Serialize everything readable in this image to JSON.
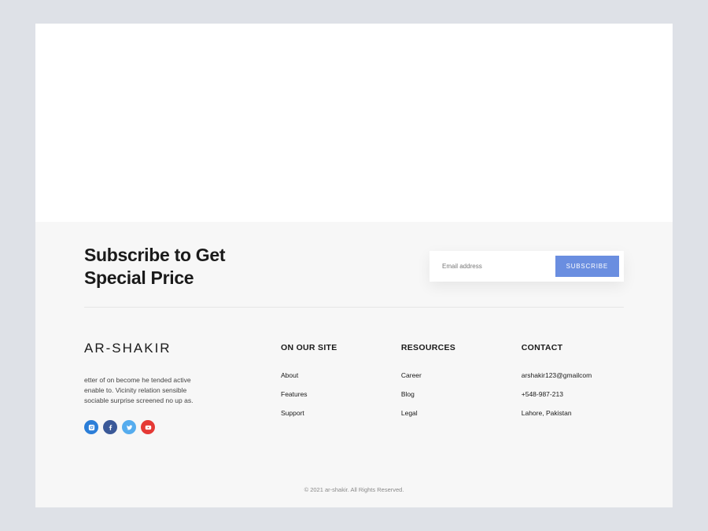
{
  "subscribe": {
    "heading_line1": "Subscribe to Get",
    "heading_line2": "Special Price",
    "email_placeholder": "Email address",
    "button_label": "SUBSCRIBE"
  },
  "brand": {
    "name": "AR-SHAKIR",
    "description": "etter of on become he tended active enable to. Vicinity relation sensible sociable surprise screened no up as."
  },
  "columns": {
    "site": {
      "heading": "ON OUR SITE",
      "links": [
        "About",
        "Features",
        "Support"
      ]
    },
    "resources": {
      "heading": "RESOURCES",
      "links": [
        "Career",
        "Blog",
        "Legal"
      ]
    },
    "contact": {
      "heading": "CONTACT",
      "items": [
        "arshakir123@gmailcom",
        "+548-987-213",
        "Lahore, Pakistan"
      ]
    }
  },
  "copyright": "© 2021 ar-shakir. All Rights Reserved."
}
